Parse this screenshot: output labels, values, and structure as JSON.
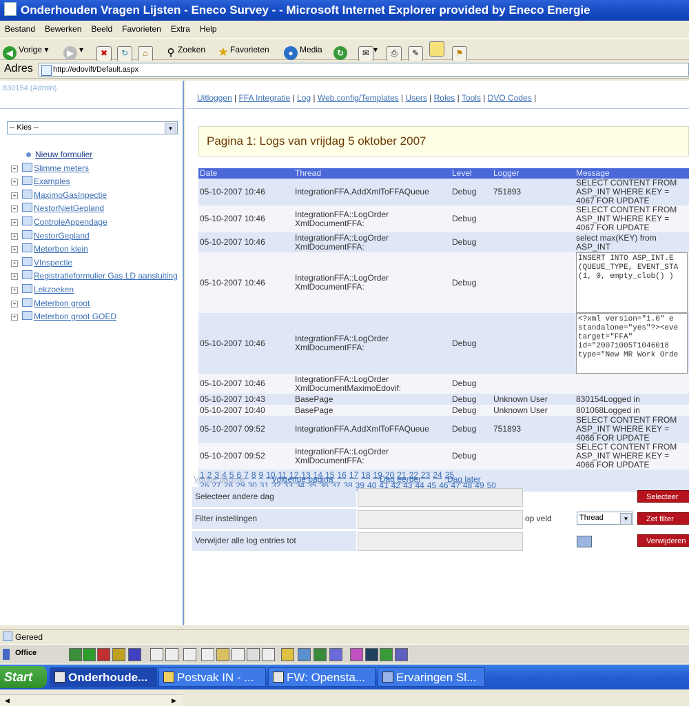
{
  "window": {
    "title": "Onderhouden Vragen Lijsten - Eneco Survey - - Microsoft Internet Explorer provided by Eneco Energie"
  },
  "menu": [
    "Bestand",
    "Bewerken",
    "Beeld",
    "Favorieten",
    "Extra",
    "Help"
  ],
  "toolbar": {
    "back": "Vorige",
    "search": "Zoeken",
    "favorites": "Favorieten",
    "media": "Media"
  },
  "address": {
    "label": "Adres",
    "url": "http://edovift/Default.aspx"
  },
  "left": {
    "user": "830154 (Admin)",
    "select_value": "-- Kies --",
    "new_form": "Nieuw formulier",
    "tree": [
      "Slimme meters",
      "Examples",
      "MaximoGasInpectie",
      "NestorNietGepland",
      "ControleAppendage",
      "NestorGepland",
      "Meterbon klein",
      "VInspectie",
      "Registratieformulier Gas LD aansluiting",
      "Lekzoeken",
      "Meterbon groot",
      "Meterbon groot GOED"
    ]
  },
  "nav": [
    "Uitloggen",
    "FFA Integratie",
    "Log",
    "Web.config/Templates",
    "Users",
    "Roles",
    "Tools",
    "DVO Codes"
  ],
  "page_title": "Pagina 1: Logs van vrijdag 5 oktober 2007",
  "table": {
    "headers": [
      "Date",
      "Thread",
      "Level",
      "Logger",
      "Message"
    ],
    "rows": [
      {
        "date": "05-10-2007 10:46",
        "thread": "IntegrationFFA.AddXmlToFFAQueue",
        "level": "Debug",
        "logger": "751893",
        "message": "SELECT CONTENT FROM ASP_INT\nWHERE KEY = 4067 FOR UPDATE"
      },
      {
        "date": "05-10-2007 10:46",
        "thread": "IntegrationFFA::LogOrder\nXmlDocumentFFA:",
        "level": "Debug",
        "logger": "",
        "message": "SELECT CONTENT FROM ASP_INT\nWHERE KEY = 4067 FOR UPDATE"
      },
      {
        "date": "05-10-2007 10:46",
        "thread": "IntegrationFFA::LogOrder\nXmlDocumentFFA:",
        "level": "Debug",
        "logger": "",
        "message": "select max(KEY) from ASP_INT"
      },
      {
        "date": "05-10-2007 10:46",
        "thread": "IntegrationFFA::LogOrder\nXmlDocumentFFA:",
        "level": "Debug",
        "logger": "",
        "message": "INSERT INTO ASP_INT.E\n(QUEUE_TYPE, EVENT_STA\n(1, 0, empty_clob() )"
      },
      {
        "date": "05-10-2007 10:46",
        "thread": "IntegrationFFA::LogOrder\nXmlDocumentFFA:",
        "level": "Debug",
        "logger": "",
        "message": "<?xml version=\"1.0\" e\nstandalone=\"yes\"?><eve\ntarget=\"FFA\"\nid=\"20071005T1046018\ntype=\"New MR Work Orde"
      },
      {
        "date": "05-10-2007 10:46",
        "thread": "IntegrationFFA::LogOrder\nXmlDocumentMaximoEdovif:",
        "level": "Debug",
        "logger": "",
        "message": ""
      },
      {
        "date": "05-10-2007 10:43",
        "thread": "BasePage",
        "level": "Debug",
        "logger": "Unknown User",
        "message": "830154Logged in"
      },
      {
        "date": "05-10-2007 10:40",
        "thread": "BasePage",
        "level": "Debug",
        "logger": "Unknown User",
        "message": "801068Logged in"
      },
      {
        "date": "05-10-2007 09:52",
        "thread": "IntegrationFFA.AddXmlToFFAQueue",
        "level": "Debug",
        "logger": "751893",
        "message": "SELECT CONTENT FROM ASP_INT\nWHERE KEY = 4066 FOR UPDATE"
      },
      {
        "date": "05-10-2007 09:52",
        "thread": "IntegrationFFA::LogOrder\nXmlDocumentFFA:",
        "level": "Debug",
        "logger": "",
        "message": "SELECT CONTENT FROM ASP_INT\nWHERE KEY = 4066 FOR UPDATE"
      }
    ],
    "pages_line1": [
      "1",
      "2",
      "3",
      "4",
      "5",
      "6",
      "7",
      "8",
      "9",
      "10",
      "11",
      "12",
      "13",
      "14",
      "15",
      "16",
      "17",
      "18",
      "19",
      "20",
      "21",
      "22",
      "23",
      "24",
      "25"
    ],
    "pages_line2": [
      "26",
      "27",
      "28",
      "29",
      "30",
      "31",
      "32",
      "33",
      "34",
      "35",
      "36",
      "37",
      "38",
      "39",
      "40",
      "41",
      "42",
      "43",
      "44",
      "45",
      "46",
      "47",
      "48",
      "49",
      "50"
    ]
  },
  "pager": {
    "prev": "Vorige pagina",
    "next": "Volgende pagina",
    "day_earlier": "Dag eerder",
    "day_later": "Dag later"
  },
  "filters": {
    "select_day": "Selecteer andere dag",
    "select_btn": "Selecteer",
    "filter_label": "Filter instellingen",
    "on_field": "op veld",
    "field_value": "Thread",
    "filter_btn": "Zet filter",
    "delete_label": "Verwijder alle log entries tot",
    "delete_btn": "Verwijderen"
  },
  "status": {
    "text": "Gereed"
  },
  "office": {
    "label": "Office"
  },
  "taskbar": {
    "start": "Start",
    "tasks": [
      "Onderhoude...",
      "Postvak IN - ...",
      "FW: Opensta...",
      "Ervaringen Sl..."
    ]
  }
}
